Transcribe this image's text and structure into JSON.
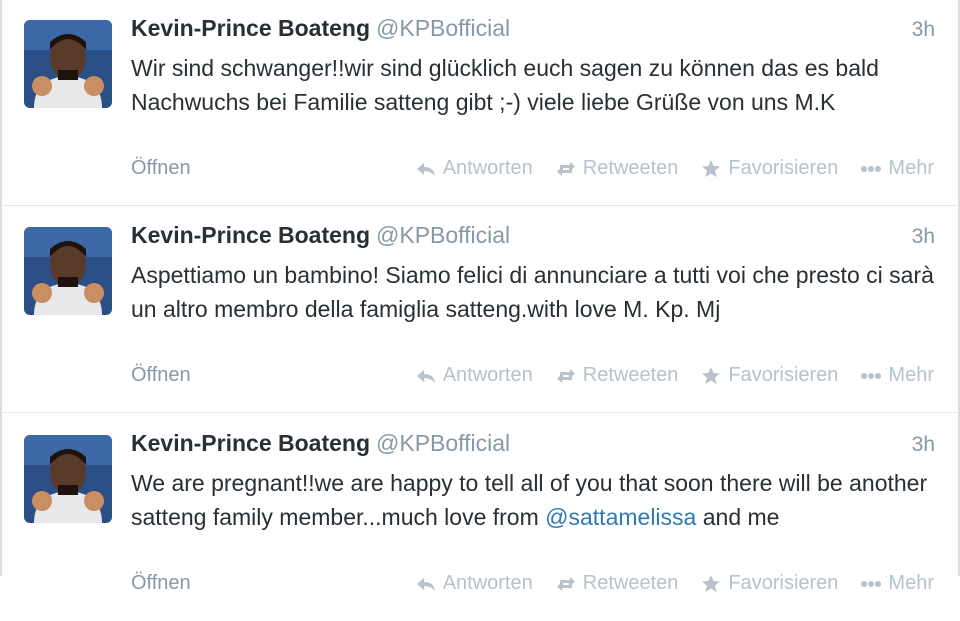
{
  "tweets": [
    {
      "name": "Kevin-Prince Boateng",
      "handle": "@KPBofficial",
      "time": "3h",
      "text": "Wir sind schwanger!!wir sind glücklich euch sagen zu können das es bald Nachwuchs bei Familie satteng gibt ;-) viele liebe Grüße von uns M.K",
      "mention": "",
      "text_tail": "",
      "open": "Öffnen",
      "reply": "Antworten",
      "retweet": "Retweeten",
      "favorite": "Favorisieren",
      "more": "Mehr"
    },
    {
      "name": "Kevin-Prince Boateng",
      "handle": "@KPBofficial",
      "time": "3h",
      "text": "Aspettiamo un bambino! Siamo felici di annunciare a tutti voi che presto ci sarà un altro membro della famiglia satteng.with love M. Kp. Mj",
      "mention": "",
      "text_tail": "",
      "open": "Öffnen",
      "reply": "Antworten",
      "retweet": "Retweeten",
      "favorite": "Favorisieren",
      "more": "Mehr"
    },
    {
      "name": "Kevin-Prince Boateng",
      "handle": "@KPBofficial",
      "time": "3h",
      "text": "We are pregnant!!we are happy to tell all of you that soon there will be another satteng family member...much love from ",
      "mention": "@sattamelissa",
      "text_tail": " and me",
      "open": "Öffnen",
      "reply": "Antworten",
      "retweet": "Retweeten",
      "favorite": "Favorisieren",
      "more": "Mehr"
    }
  ],
  "colors": {
    "link": "#2b7bb9",
    "muted": "#8899a6",
    "action": "#b7c2cc"
  },
  "icons": [
    "reply-icon",
    "retweet-icon",
    "star-icon",
    "more-icon"
  ]
}
